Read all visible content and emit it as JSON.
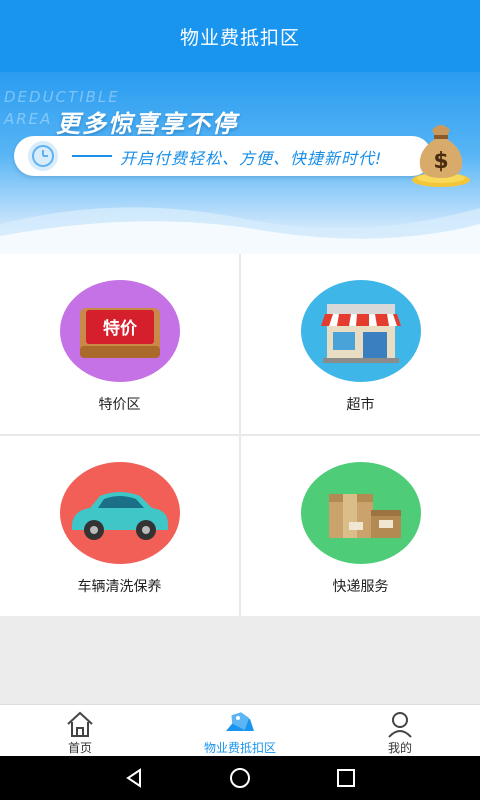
{
  "header": {
    "title": "物业费抵扣区"
  },
  "banner": {
    "watermark_line1": "DEDUCTIBLE",
    "watermark_line2": "AREA",
    "headline": "更多惊喜享不停",
    "slogan": "开启付费轻松、方便、快捷新时代!",
    "icons": [
      "clock-icon",
      "money-bag-icon"
    ]
  },
  "categories": [
    {
      "label": "特价区",
      "icon": "special-price-icon",
      "badge_text": "特价",
      "color": "#c472e6"
    },
    {
      "label": "超市",
      "icon": "supermarket-icon",
      "color": "#3fb6e8"
    },
    {
      "label": "车辆清洗保养",
      "icon": "car-icon",
      "color": "#f25f57"
    },
    {
      "label": "快递服务",
      "icon": "package-icon",
      "color": "#4fcc77"
    }
  ],
  "tabbar": {
    "tabs": [
      {
        "label": "首页",
        "icon": "home-icon",
        "active": false
      },
      {
        "label": "物业费抵扣区",
        "icon": "price-tag-icon",
        "active": true
      },
      {
        "label": "我的",
        "icon": "user-icon",
        "active": false
      }
    ]
  },
  "system_nav": {
    "buttons": [
      "back-icon",
      "home-circle-icon",
      "recents-icon"
    ]
  },
  "colors": {
    "primary": "#1a95ef",
    "background": "#ececec"
  }
}
